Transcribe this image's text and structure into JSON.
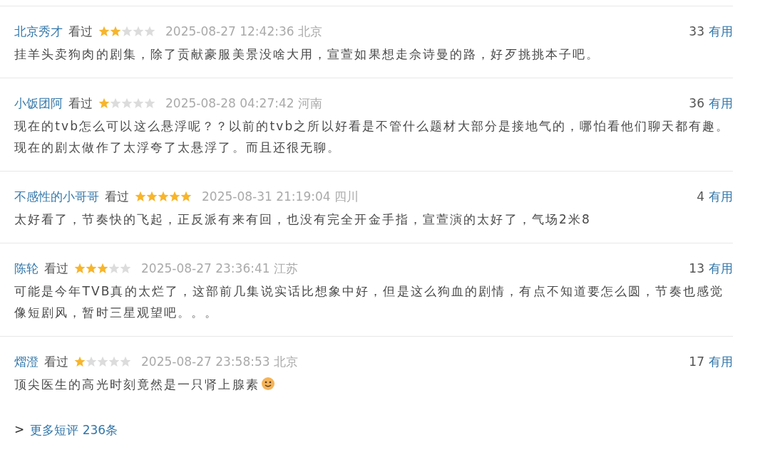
{
  "reviews": [
    {
      "user": "北京秀才",
      "status": "看过",
      "stars": 2,
      "time": "2025-08-27 12:42:36 北京",
      "votes": "33",
      "vote_label": "有用",
      "text": "挂羊头卖狗肉的剧集，除了贡献豪服美景没啥大用，宣萱如果想走佘诗曼的路，好歹挑挑本子吧。"
    },
    {
      "user": "小饭团阿",
      "status": "看过",
      "stars": 1,
      "time": "2025-08-28 04:27:42 河南",
      "votes": "36",
      "vote_label": "有用",
      "text": "现在的tvb怎么可以这么悬浮呢？？以前的tvb之所以好看是不管什么题材大部分是接地气的，哪怕看他们聊天都有趣。现在的剧太做作了太浮夸了太悬浮了。而且还很无聊。"
    },
    {
      "user": "不感性的小哥哥",
      "status": "看过",
      "stars": 5,
      "time": "2025-08-31 21:19:04 四川",
      "votes": "4",
      "vote_label": "有用",
      "text": "太好看了，节奏快的飞起，正反派有来有回，也没有完全开金手指，宣萱演的太好了，气场2米8"
    },
    {
      "user": "陈轮",
      "status": "看过",
      "stars": 3,
      "time": "2025-08-27 23:36:41 江苏",
      "votes": "13",
      "vote_label": "有用",
      "text": "可能是今年TVB真的太烂了，这部前几集说实话比想象中好，但是这么狗血的剧情，有点不知道要怎么圆，节奏也感觉像短剧风，暂时三星观望吧。。。"
    },
    {
      "user": "熠澄",
      "status": "看过",
      "stars": 1,
      "time": "2025-08-27 23:58:53 北京",
      "votes": "17",
      "vote_label": "有用",
      "text": "顶尖医生的高光时刻竟然是一只肾上腺素",
      "emoji": true
    }
  ],
  "more": {
    "prefix": ">",
    "label": "更多短评 236条"
  }
}
